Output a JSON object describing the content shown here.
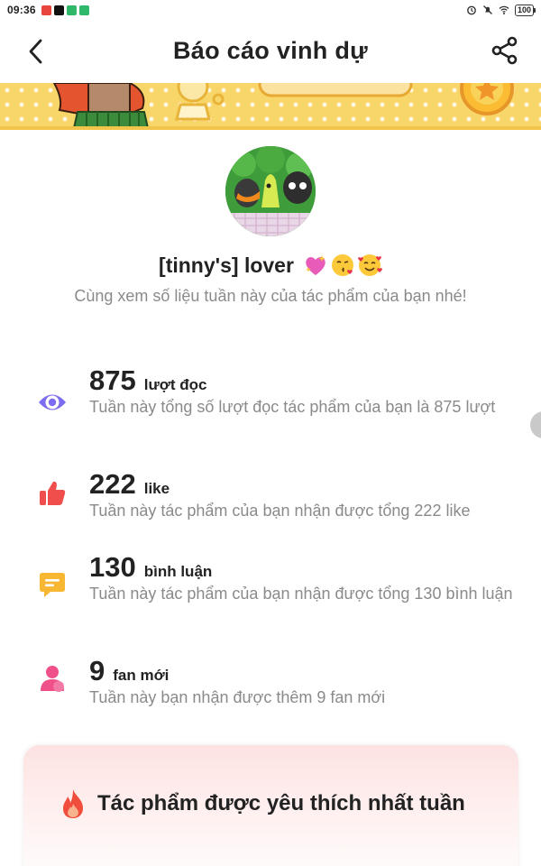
{
  "status_bar": {
    "time": "09:36",
    "battery": "100",
    "app_icons": [
      "notes-app-icon",
      "tiktok-icon",
      "green-app-icon",
      "green-app-icon"
    ],
    "system_icons": [
      "alarm-icon",
      "mute-icon",
      "wifi-icon",
      "battery-icon"
    ]
  },
  "header": {
    "title": "Báo cáo vinh dự",
    "back_icon": "back-arrow-icon",
    "share_icon": "share-icon"
  },
  "profile": {
    "username": "[tinny's] lover",
    "emojis": [
      "sparkling-heart-emoji",
      "kissing-face-emoji",
      "smiling-face-with-hearts-emoji"
    ],
    "subtitle": "Cùng xem số liệu tuần này của tác phẩm của bạn nhé!"
  },
  "stats": [
    {
      "number": "875",
      "unit": "lượt đọc",
      "description": "Tuần này tổng số lượt đọc tác phẩm của bạn là 875 lượt",
      "icon": "eye-icon",
      "color": "#7b6cf0"
    },
    {
      "number": "222",
      "unit": "like",
      "description": "Tuần này tác phẩm của bạn nhận được tổng 222 like",
      "icon": "thumbs-up-icon",
      "color": "#f04d4d"
    },
    {
      "number": "130",
      "unit": "bình luận",
      "description": "Tuần này tác phẩm của bạn nhận được tổng 130 bình luận",
      "icon": "comment-icon",
      "color": "#f7b733"
    },
    {
      "number": "9",
      "unit": "fan mới",
      "description": "Tuần này bạn nhận được thêm 9 fan mới",
      "icon": "user-icon",
      "color": "#f0508a"
    }
  ],
  "favorite": {
    "title": "Tác phẩm được yêu thích nhất tuần",
    "icon": "fire-icon"
  },
  "colors": {
    "banner": "#f8d66a",
    "card_top": "#fde2e2"
  }
}
